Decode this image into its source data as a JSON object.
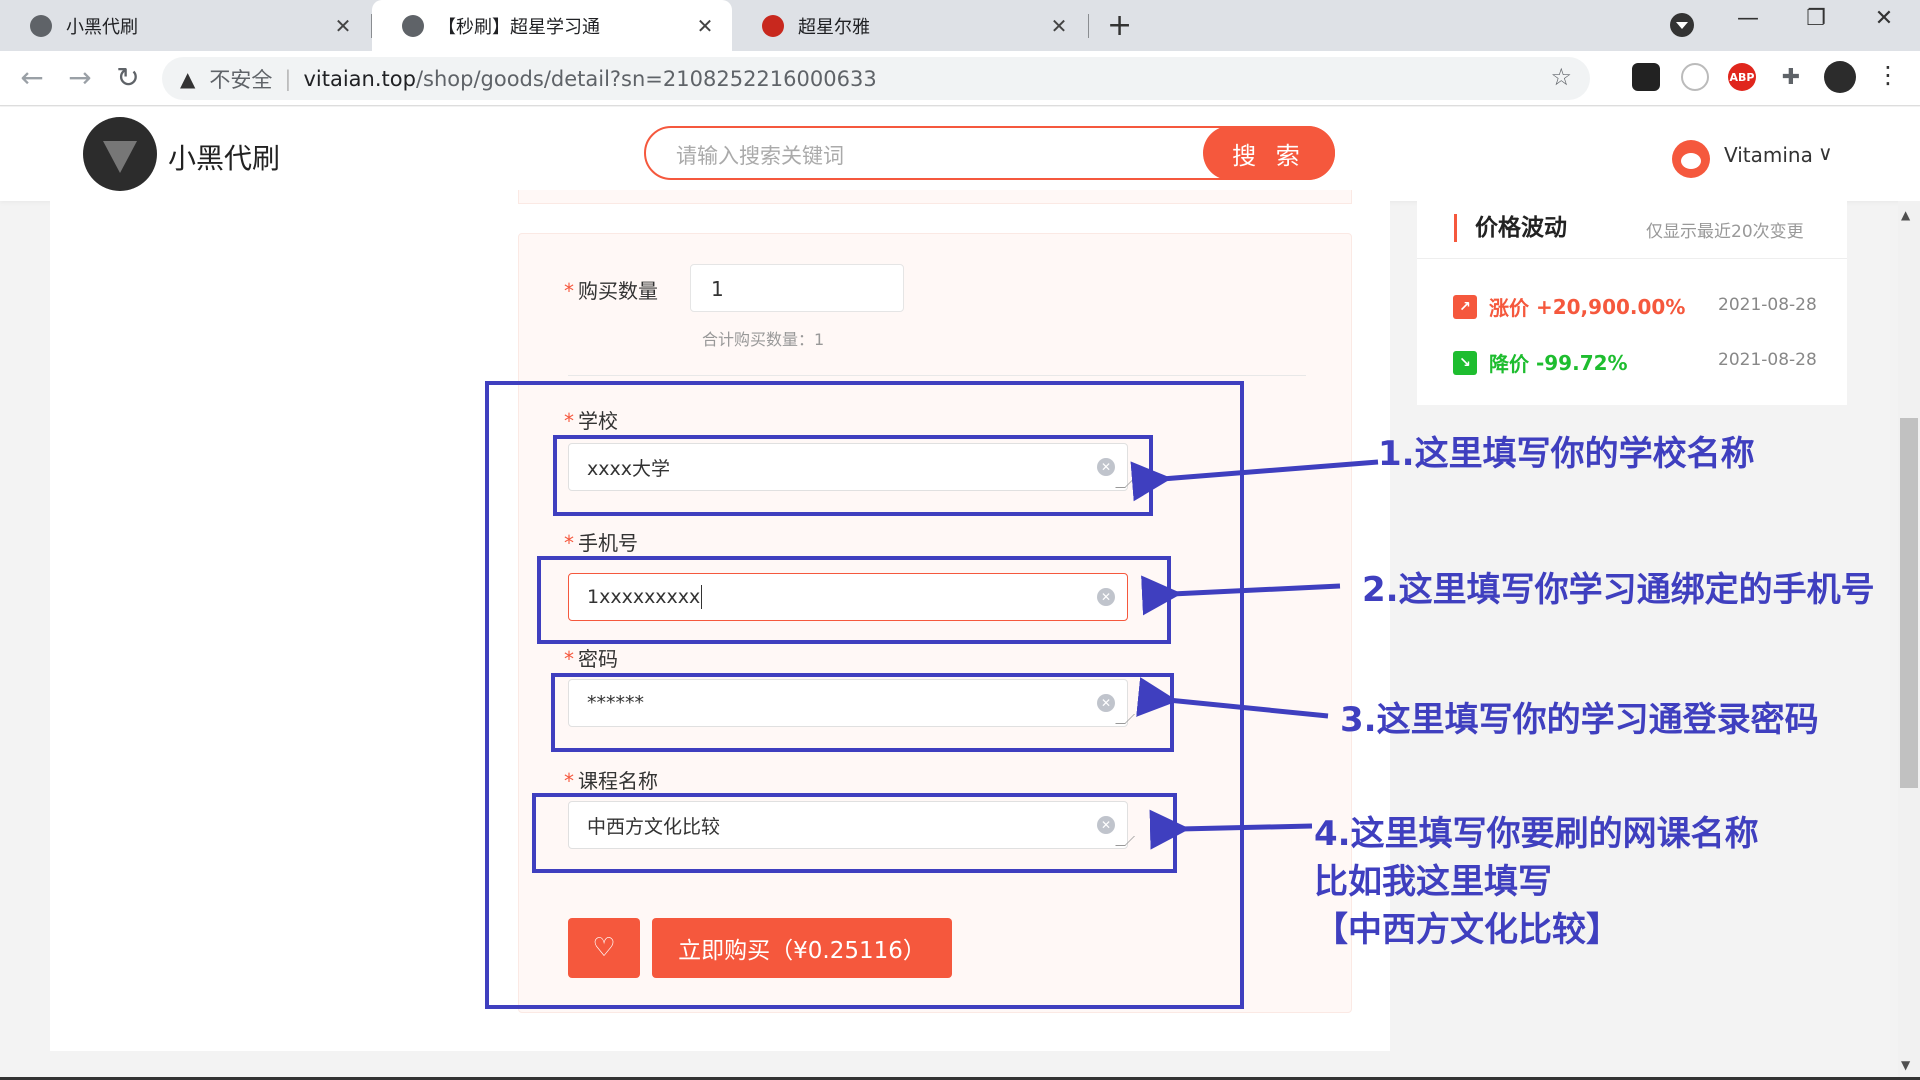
{
  "browser": {
    "tabs": [
      {
        "title": "小黑代刷",
        "close": "✕"
      },
      {
        "title": "【秒刷】超星学习通",
        "close": "✕"
      },
      {
        "title": "超星尔雅",
        "close": "✕"
      }
    ],
    "new_tab": "+",
    "window_controls": {
      "minimize": "—",
      "maximize": "❐",
      "close": "✕"
    },
    "nav": {
      "back": "←",
      "forward": "→",
      "reload": "↻"
    },
    "address": {
      "security_icon": "warning-triangle-icon",
      "security_label": "不安全",
      "separator": "|",
      "host": "vitaian.top",
      "path": "/shop/goods/detail?sn=2108252216000633"
    },
    "bookmark_icon": "☆",
    "extensions": [
      "tampermonkey-icon",
      "extension-circle-icon",
      "adblock-plus-icon",
      "puzzle-icon",
      "profile-icon"
    ],
    "abp_label": "ABP",
    "menu": "⋮"
  },
  "site": {
    "name": "小黑代刷",
    "search": {
      "placeholder": "请输入搜索关键词",
      "button": "搜 索"
    },
    "user": {
      "name": "Vitamina",
      "chevron": "∨"
    }
  },
  "form": {
    "quantity": {
      "label": "购买数量",
      "value": "1",
      "summary": "合计购买数量：1"
    },
    "required_mark": "*",
    "fields": [
      {
        "label": "学校",
        "value": "xxxx大学"
      },
      {
        "label": "手机号",
        "value": "1xxxxxxxxx"
      },
      {
        "label": "密码",
        "value": "******"
      },
      {
        "label": "课程名称",
        "value": "中西方文化比较"
      }
    ],
    "favorite_icon": "♡",
    "buy_button": "立即购买（¥0.25116）"
  },
  "price_trend": {
    "title": "价格波动",
    "note": "仅显示最近20次变更",
    "items": [
      {
        "kind": "涨价",
        "value": "+20,900.00%",
        "date": "2021-08-28",
        "color": "#f5583d"
      },
      {
        "kind": "降价",
        "value": "-99.72%",
        "date": "2021-08-28",
        "color": "#1ebd2f"
      }
    ]
  },
  "annotations": [
    {
      "lines": [
        "1.这里填写你的学校名称"
      ]
    },
    {
      "lines": [
        "2.这里填写你学习通绑定的手机号"
      ]
    },
    {
      "lines": [
        "3.这里填写你的学习通登录密码"
      ]
    },
    {
      "lines": [
        "4.这里填写你要刷的网课名称",
        "比如我这里填写",
        "【中西方文化比较】"
      ]
    }
  ],
  "colors": {
    "accent": "#f5583d",
    "annotation": "#3f3fbf",
    "up": "#f5583d",
    "down": "#1ebd2f"
  }
}
